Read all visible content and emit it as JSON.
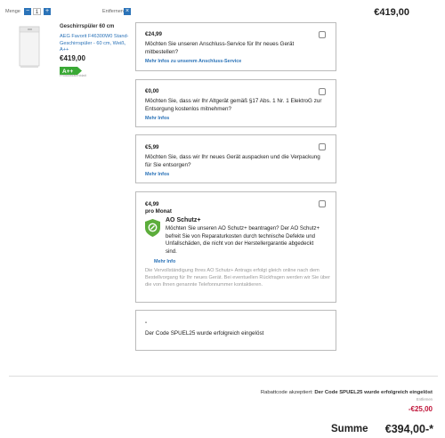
{
  "quantity": {
    "label": "Menge",
    "minus": "−",
    "value": "1",
    "plus": "+"
  },
  "remove": {
    "label": "Entfernen",
    "icon": "×"
  },
  "top_price": "€419,00",
  "product": {
    "category": "Geschirrspüler 60 cm",
    "name": "AEG Favorit F46300W0 Stand-Geschirrspüler - 60 cm, Weiß, A++",
    "price": "€419,00",
    "energy_class": "A++",
    "energy_note": "Produktdatenblatt"
  },
  "options": [
    {
      "price": "€24,99",
      "text": "Möchten Sie unseren Anschluss-Service für Ihr neues Gerät mitbestellen?",
      "link": "Mehr Infos zu unserem Anschluss-Service"
    },
    {
      "price": "€0,00",
      "text": "Möchten Sie, dass wir Ihr Altgerät gemäß §17 Abs. 1 Nr. 1 ElektroG zur Entsorgung kostenlos mitnehmen?",
      "link": "Mehr Infos"
    },
    {
      "price": "€5,99",
      "text": "Möchten Sie, dass wir Ihr neues Gerät auspacken und die Verpackung für Sie entsorgen?",
      "link": "Mehr Infos"
    }
  ],
  "ao": {
    "price": "€4,99",
    "period": "pro Monat",
    "title": "AO Schutz+",
    "text": "Möchten Sie unseren AO Schutz+ beantragen? Der AO Schutz+ befreit Sie von Reparaturkosten durch technische Defekte und Unfallschäden, die nicht von der Herstellergarantie abgedeckt sind.",
    "link": "Mehr Info",
    "note": "Die Vervollständigung Ihres AO Schutz+ Antrags erfolgt gleich online nach dem Bestellvorgang für Ihr neues Gerät. Bei eventuellen Rückfragen werden wir Sie über die von Ihnen genannte Telefonnummer kontaktieren."
  },
  "coupon": {
    "dash": "-",
    "text": "Der Code SPUEL25 wurde erfolgreich eingelöst"
  },
  "summary": {
    "rabatt_prefix": "Rabattcode akzeptiert:",
    "rabatt_text": "Der Code SPUEL25 wurde erfolgreich eingelöst",
    "remove": "Entfernen",
    "discount": "-€25,00",
    "sum_label": "Summe",
    "sum_value": "€394,00-*"
  },
  "colors": {
    "accent": "#2b73b8",
    "energy_green": "#3aa935",
    "ao_green": "#5cad3b",
    "discount_red": "#c0163a"
  }
}
